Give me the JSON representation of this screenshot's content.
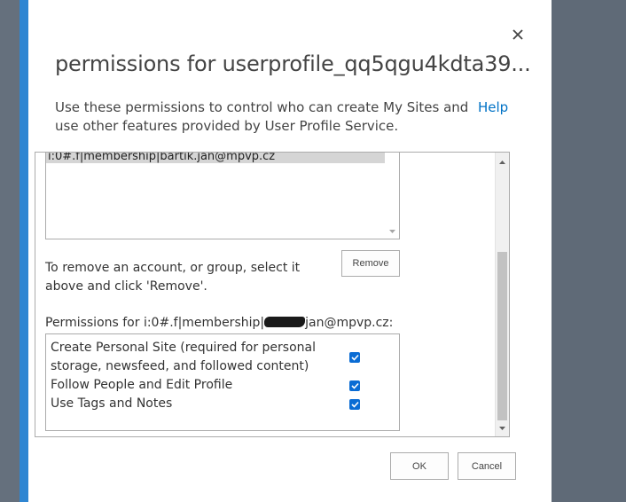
{
  "dialog": {
    "title": "permissions for userprofile_qq5qgu4kdta39...",
    "description": "Use these permissions to control who can create My Sites and use other features provided by User Profile Service.",
    "help_label": "Help",
    "close_icon": "close-icon",
    "accent_color": "#2f86d2"
  },
  "users_list": {
    "items": [
      "i:0#.f|membership|bartik.jan@mpvp.cz"
    ]
  },
  "remove": {
    "instructions": "To remove an account, or group, select it above and click 'Remove'.",
    "button_label": "Remove"
  },
  "permissions": {
    "label_prefix": "Permissions for i:0#.f|membership|",
    "label_suffix": "jan@mpvp.cz:",
    "items": [
      {
        "label": "Create Personal Site (required for personal storage, newsfeed, and followed content)",
        "checked": true
      },
      {
        "label": "Follow People and Edit Profile",
        "checked": true
      },
      {
        "label": "Use Tags and Notes",
        "checked": true
      }
    ]
  },
  "footer": {
    "ok_label": "OK",
    "cancel_label": "Cancel"
  }
}
